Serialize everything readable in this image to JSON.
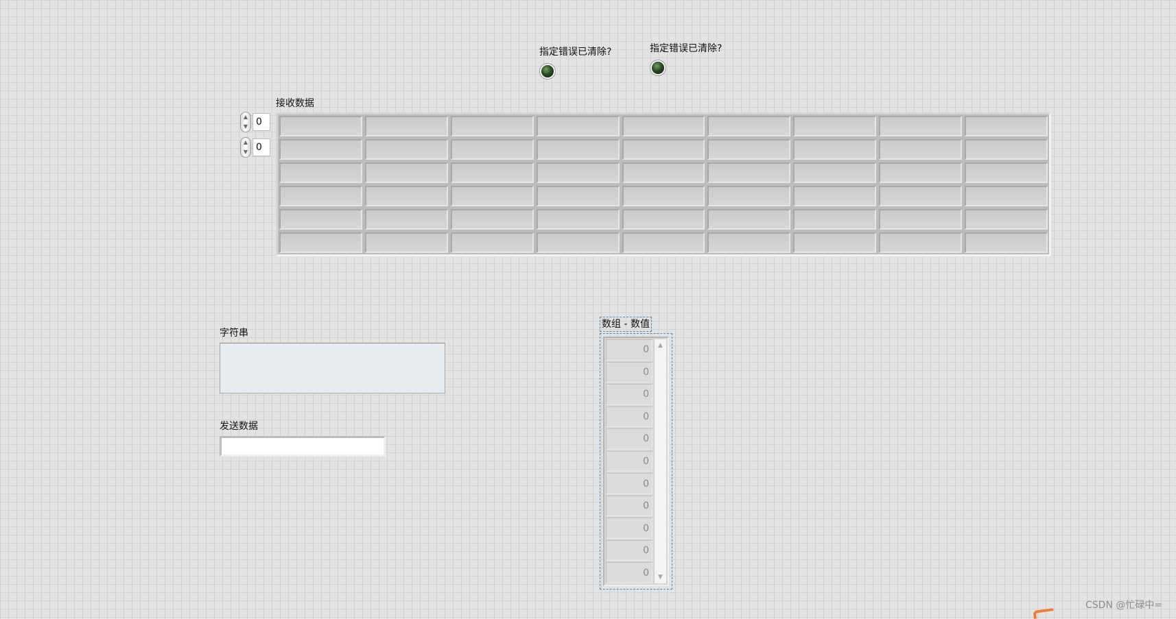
{
  "indicators": {
    "led1": {
      "label": "指定错误已清除?",
      "state": "off",
      "color": "#2a4b24"
    },
    "led2": {
      "label": "指定错误已清除?",
      "state": "off",
      "color": "#2a4b24"
    }
  },
  "receive_data": {
    "label": "接收数据",
    "row_index": "0",
    "col_index": "0",
    "rows": 6,
    "columns": 9
  },
  "string_indicator": {
    "label": "字符串",
    "value": ""
  },
  "send_data": {
    "label": "发送数据",
    "value": ""
  },
  "numeric_array": {
    "label": "数组 - 数值",
    "values": [
      "0",
      "0",
      "0",
      "0",
      "0",
      "0",
      "0",
      "0",
      "0",
      "0",
      "0"
    ]
  },
  "watermark": {
    "text": "CSDN @忙碌中="
  }
}
